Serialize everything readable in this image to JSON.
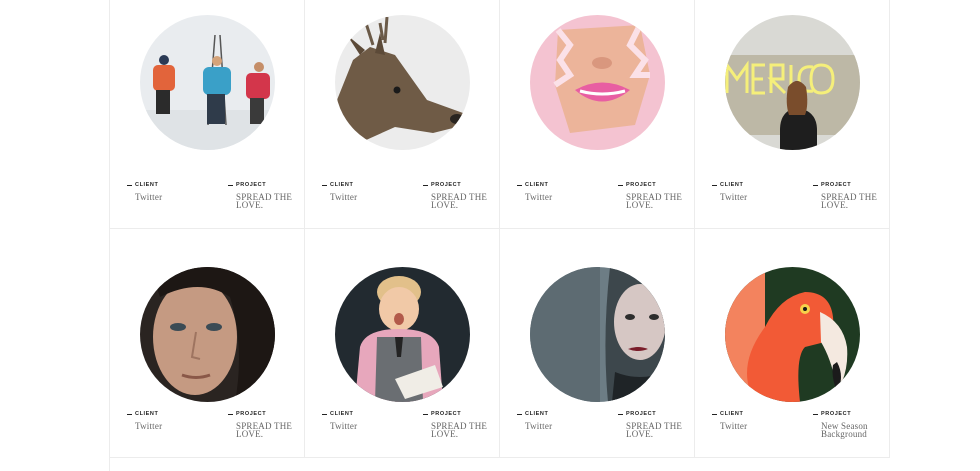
{
  "labels": {
    "client": "Client",
    "project": "Project"
  },
  "cards": [
    {
      "client": "Twitter",
      "project": "SPREAD THE LOVE.",
      "image": "hikers-snow"
    },
    {
      "client": "Twitter",
      "project": "SPREAD THE LOVE.",
      "image": "deer"
    },
    {
      "client": "Twitter",
      "project": "SPREAD THE LOVE.",
      "image": "lips-paper"
    },
    {
      "client": "Twitter",
      "project": "SPREAD THE LOVE.",
      "image": "neon-sign-woman"
    },
    {
      "client": "Twitter",
      "project": "SPREAD THE LOVE.",
      "image": "girl-portrait"
    },
    {
      "client": "Twitter",
      "project": "SPREAD THE LOVE.",
      "image": "boy-reading"
    },
    {
      "client": "Twitter",
      "project": "SPREAD THE LOVE.",
      "image": "woman-blue"
    },
    {
      "client": "Twitter",
      "project": "New Season Background",
      "image": "flamingo"
    }
  ]
}
